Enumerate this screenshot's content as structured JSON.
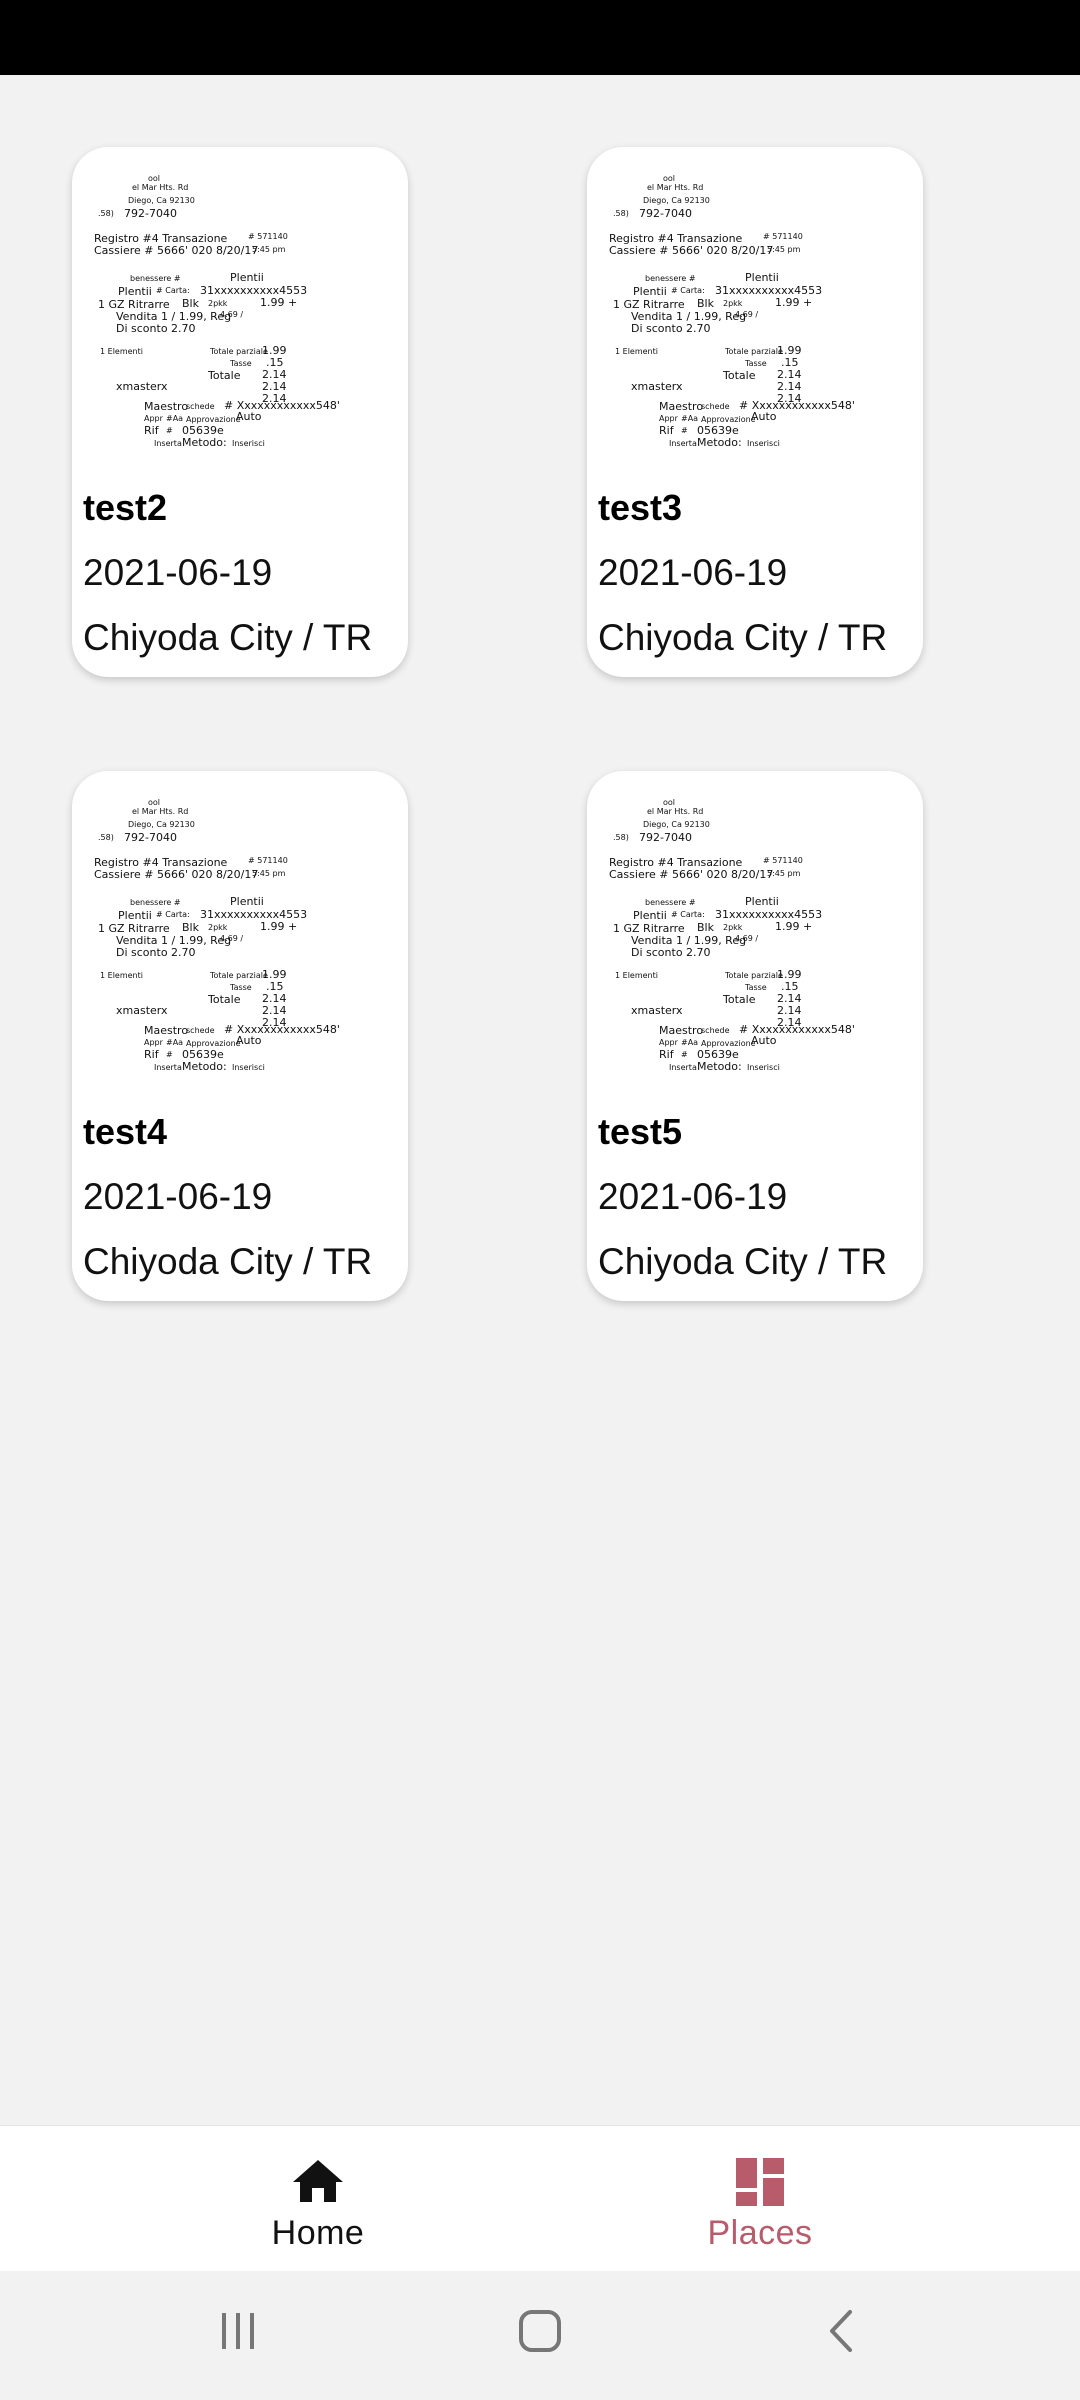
{
  "cards": [
    {
      "title": "test2",
      "date": "2021-06-19",
      "place": "Chiyoda City / TR"
    },
    {
      "title": "test3",
      "date": "2021-06-19",
      "place": "Chiyoda City / TR"
    },
    {
      "title": "test4",
      "date": "2021-06-19",
      "place": "Chiyoda City / TR"
    },
    {
      "title": "test5",
      "date": "2021-06-19",
      "place": "Chiyoda City / TR"
    }
  ],
  "receipt": {
    "lines": {
      "l1": "ool",
      "l2": "el  Mar  Hts. Rd",
      "l3": "Diego,    Ca    92130",
      "l4": ".58)",
      "l5": "792-7040",
      "l6": "Registro   #4  Transazione",
      "l6b": "# 571140",
      "l7": "Cassiere  # 5666' 020   8/20/17",
      "l7b": "5:45 pm",
      "l8": "benessere #",
      "l8b": "Plentii",
      "l9": "Plentii",
      "l9b": "# Carta:",
      "l9c": "31xxxxxxxxxx4553",
      "l10": "1  GZ  Ritrarre",
      "l10b": "Blk",
      "l10c": "2pkk",
      "l10d": "1.99 +",
      "l11": "Vendita   1 / 1.99,  Reg",
      "l11b": "4.69 /",
      "l12": "Di sconto    2.70",
      "l13": "1  Elementi",
      "l13b": "Totale parziale",
      "l13c": "1.99",
      "l14": "Tasse",
      "l14b": ".15",
      "l15": "Totale",
      "l15b": "2.14",
      "l16": "2.14",
      "l17": "xmasterx",
      "l17b": "2.14",
      "l18": "Maestro",
      "l18b": "schede",
      "l18c": "# Xxxxxxxxxxxx548'",
      "l19": "Appr",
      "l19b": "#Aa",
      "l19c": "Approvazione",
      "l19d": "Auto",
      "l20": "Rif",
      "l20b": "#",
      "l20c": "05639e",
      "l21": "Inserta",
      "l21b": "Metodo:",
      "l21c": "Inserisci"
    }
  },
  "nav": {
    "home_label": "Home",
    "places_label": "Places",
    "active": "places",
    "active_color": "#b85c6c",
    "inactive_color": "#111111"
  }
}
